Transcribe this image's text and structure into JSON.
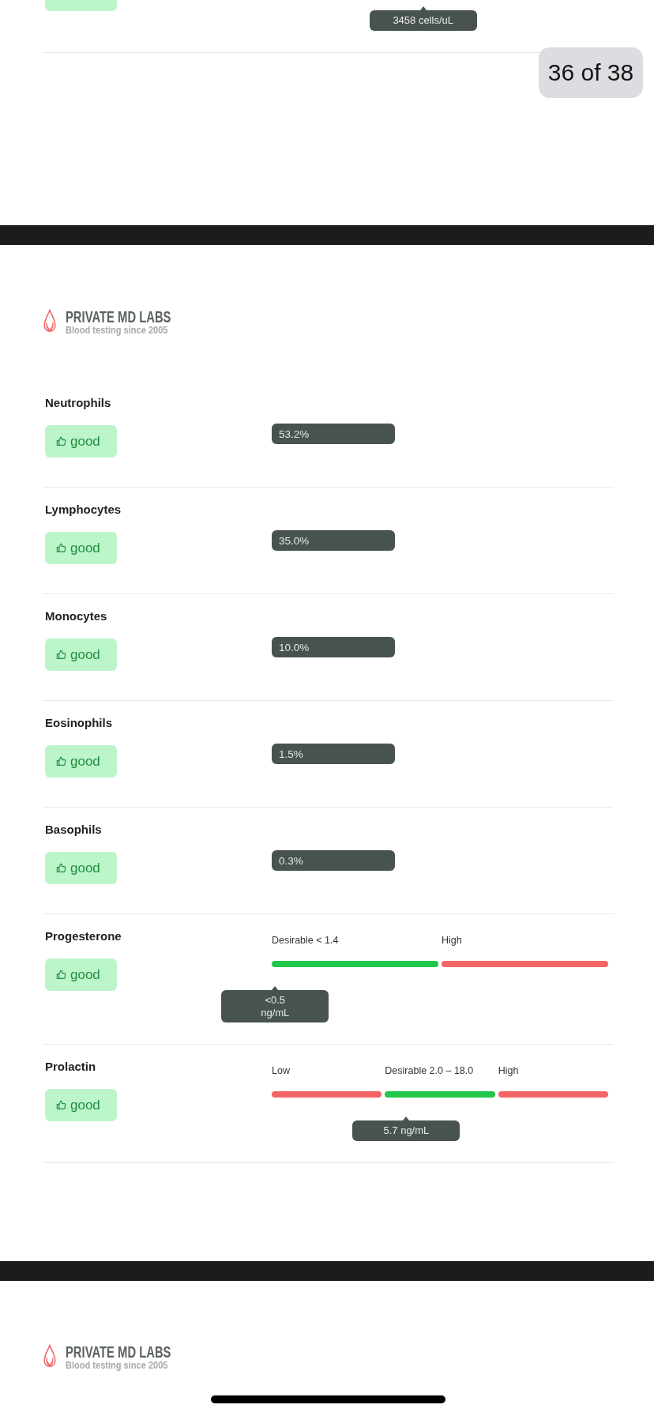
{
  "previous_section": {
    "tooltip": {
      "value": "3458 cells/uL",
      "level": 0.45
    }
  },
  "page_counter": "36 of 38",
  "pages": [
    {
      "logo": {
        "name": "PRIVATE MD LABS",
        "tagline": "Blood testing since 2005"
      },
      "results": [
        {
          "kind": "value",
          "name": "Neutrophils",
          "status": "good",
          "value": "53.2%"
        },
        {
          "kind": "value",
          "name": "Lymphocytes",
          "status": "good",
          "value": "35.0%"
        },
        {
          "kind": "value",
          "name": "Monocytes",
          "status": "good",
          "value": "10.0%"
        },
        {
          "kind": "value",
          "name": "Eosinophils",
          "status": "good",
          "value": "1.5%"
        },
        {
          "kind": "value",
          "name": "Basophils",
          "status": "good",
          "value": "0.3%"
        },
        {
          "kind": "range",
          "name": "Progesterone",
          "status": "good",
          "segments": [
            {
              "label": "Desirable < 1.4",
              "color": "#21c74a"
            },
            {
              "label": "High",
              "color": "#f46565"
            }
          ],
          "tooltip": {
            "value": "<0.5\nng/mL",
            "level": 0.01
          }
        },
        {
          "kind": "range",
          "name": "Prolactin",
          "status": "good",
          "segments": [
            {
              "label": "Low",
              "color": "#f46565"
            },
            {
              "label": "Desirable 2.0 – 18.0",
              "color": "#21c74a"
            },
            {
              "label": "High",
              "color": "#f46565"
            }
          ],
          "tooltip": {
            "value": "5.7 ng/mL",
            "level": 0.4
          }
        }
      ]
    },
    {
      "logo": {
        "name": "PRIVATE MD LABS",
        "tagline": "Blood testing since 2005"
      }
    }
  ]
}
